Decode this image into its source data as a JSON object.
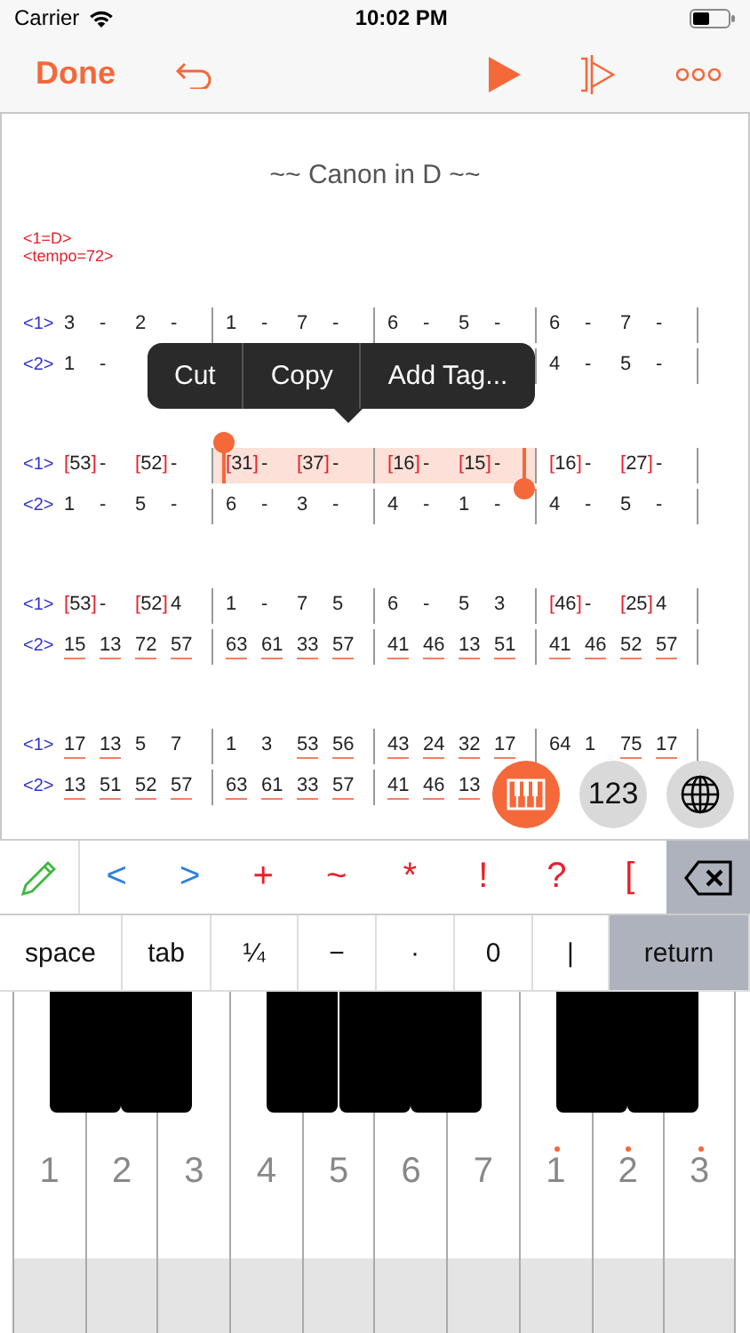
{
  "status_bar": {
    "carrier": "Carrier",
    "time": "10:02 PM"
  },
  "nav": {
    "done": "Done"
  },
  "score": {
    "title": "~~ Canon in D ~~",
    "meta": [
      "<1=D>",
      "<tempo=72>"
    ],
    "systems": [
      {
        "voices": [
          {
            "label": "<1>",
            "measures": [
              {
                "tokens": [
                  "3",
                  "-",
                  "2",
                  "-"
                ],
                "selected": false
              },
              {
                "tokens": [
                  "1",
                  "-",
                  "7",
                  "-"
                ],
                "selected": false
              },
              {
                "tokens": [
                  "6",
                  "-",
                  "5",
                  "-"
                ],
                "selected": false
              },
              {
                "tokens": [
                  "6",
                  "-",
                  "7",
                  "-"
                ],
                "selected": false
              }
            ]
          },
          {
            "label": "<2>",
            "measures": [
              {
                "kind": "notes",
                "tokens": [
                  "1",
                  "-"
                ],
                "selected": false
              },
              {
                "kind": "covered"
              },
              {
                "kind": "covered"
              },
              {
                "kind": "notes",
                "tokens": [
                  "4",
                  "-",
                  "5",
                  "-"
                ],
                "selected": false
              }
            ]
          }
        ]
      },
      {
        "voices": [
          {
            "label": "<1>",
            "measures": [
              {
                "tokens": [
                  "[53]",
                  "-",
                  "[52]",
                  "-"
                ],
                "selected": false
              },
              {
                "tokens": [
                  "[31]",
                  "-",
                  "[37]",
                  "-"
                ],
                "selected": true
              },
              {
                "tokens": [
                  "[16]",
                  "-",
                  "[15]",
                  "-"
                ],
                "selected": true
              },
              {
                "tokens": [
                  "[16]",
                  "-",
                  "[27]",
                  "-"
                ],
                "selected": false
              }
            ]
          },
          {
            "label": "<2>",
            "measures": [
              {
                "tokens": [
                  "1",
                  "-",
                  "5",
                  "-"
                ],
                "selected": false
              },
              {
                "tokens": [
                  "6",
                  "-",
                  "3",
                  "-"
                ],
                "selected": false
              },
              {
                "tokens": [
                  "4",
                  "-",
                  "1",
                  "-"
                ],
                "selected": false
              },
              {
                "tokens": [
                  "4",
                  "-",
                  "5",
                  "-"
                ],
                "selected": false
              }
            ]
          }
        ]
      },
      {
        "voices": [
          {
            "label": "<1>",
            "measures": [
              {
                "tokens": [
                  "[53]",
                  "-",
                  "[52]",
                  "4"
                ],
                "selected": false
              },
              {
                "tokens": [
                  "1",
                  "-",
                  "7",
                  "5"
                ],
                "selected": false
              },
              {
                "tokens": [
                  "6",
                  "-",
                  "5",
                  "3"
                ],
                "selected": false
              },
              {
                "tokens": [
                  "[46]",
                  "-",
                  "[25]",
                  "4"
                ],
                "selected": false
              }
            ]
          },
          {
            "label": "<2>",
            "measures": [
              {
                "tokens": [
                  "15",
                  "13",
                  "72",
                  "57"
                ],
                "beamed": [
                  true,
                  true,
                  true,
                  true
                ],
                "selected": false
              },
              {
                "tokens": [
                  "63",
                  "61",
                  "33",
                  "57"
                ],
                "beamed": [
                  true,
                  true,
                  true,
                  true
                ],
                "selected": false
              },
              {
                "tokens": [
                  "41",
                  "46",
                  "13",
                  "51"
                ],
                "beamed": [
                  true,
                  true,
                  true,
                  true
                ],
                "selected": false
              },
              {
                "tokens": [
                  "41",
                  "46",
                  "52",
                  "57"
                ],
                "beamed": [
                  true,
                  true,
                  true,
                  true
                ],
                "selected": false
              }
            ]
          }
        ]
      },
      {
        "voices": [
          {
            "label": "<1>",
            "measures": [
              {
                "tokens": [
                  "17",
                  "13",
                  "5",
                  "7"
                ],
                "beamed": [
                  true,
                  true,
                  false,
                  false
                ],
                "selected": false
              },
              {
                "tokens": [
                  "1",
                  "3",
                  "53",
                  "56"
                ],
                "beamed": [
                  false,
                  false,
                  true,
                  true
                ],
                "selected": false
              },
              {
                "tokens": [
                  "43",
                  "24",
                  "32",
                  "17"
                ],
                "beamed": [
                  true,
                  true,
                  true,
                  true
                ],
                "selected": false
              },
              {
                "tokens": [
                  "64",
                  "1",
                  "75",
                  "17"
                ],
                "beamed": [
                  false,
                  false,
                  true,
                  true
                ],
                "selected": false
              }
            ]
          },
          {
            "label": "<2>",
            "measures": [
              {
                "tokens": [
                  "13",
                  "51",
                  "52",
                  "57"
                ],
                "beamed": [
                  true,
                  true,
                  true,
                  true
                ],
                "selected": false
              },
              {
                "tokens": [
                  "63",
                  "61",
                  "33",
                  "57"
                ],
                "beamed": [
                  true,
                  true,
                  true,
                  true
                ],
                "selected": false
              },
              {
                "tokens": [
                  "41",
                  "46",
                  "13"
                ],
                "beamed": [
                  true,
                  true,
                  true
                ],
                "selected": false
              },
              {
                "kind": "covered"
              }
            ]
          }
        ]
      }
    ]
  },
  "context_menu": [
    "Cut",
    "Copy",
    "Add Tag..."
  ],
  "floating_buttons": [
    {
      "kind": "piano",
      "selected": true
    },
    {
      "kind": "numbers",
      "label": "123",
      "selected": false
    },
    {
      "kind": "globe",
      "selected": false
    }
  ],
  "symbol_bar": [
    {
      "label": "<",
      "color": "#2f7fe0"
    },
    {
      "label": ">",
      "color": "#2f7fe0"
    },
    {
      "label": "+",
      "color": "#e8202a"
    },
    {
      "label": "~",
      "color": "#e8202a"
    },
    {
      "label": "*",
      "color": "#e8202a"
    },
    {
      "label": "!",
      "color": "#e8202a"
    },
    {
      "label": "?",
      "color": "#e8202a"
    },
    {
      "label": "[",
      "color": "#e8202a"
    }
  ],
  "key_row": [
    {
      "label": "space",
      "kind": "key"
    },
    {
      "label": "tab",
      "kind": "key"
    },
    {
      "label": "¼",
      "kind": "key"
    },
    {
      "label": "−",
      "kind": "key"
    },
    {
      "label": "·",
      "kind": "key"
    },
    {
      "label": "0",
      "kind": "key"
    },
    {
      "label": "|",
      "kind": "key"
    },
    {
      "label": "return",
      "kind": "action"
    }
  ],
  "piano_keys": [
    {
      "label": "1",
      "high": false,
      "sharp": true
    },
    {
      "label": "2",
      "high": false,
      "sharp": true
    },
    {
      "label": "3",
      "high": false,
      "sharp": false
    },
    {
      "label": "4",
      "high": false,
      "sharp": true
    },
    {
      "label": "5",
      "high": false,
      "sharp": true
    },
    {
      "label": "6",
      "high": false,
      "sharp": true
    },
    {
      "label": "7",
      "high": false,
      "sharp": false
    },
    {
      "label": "1",
      "high": true,
      "sharp": true
    },
    {
      "label": "2",
      "high": true,
      "sharp": true
    },
    {
      "label": "3",
      "high": true,
      "sharp": false
    }
  ]
}
